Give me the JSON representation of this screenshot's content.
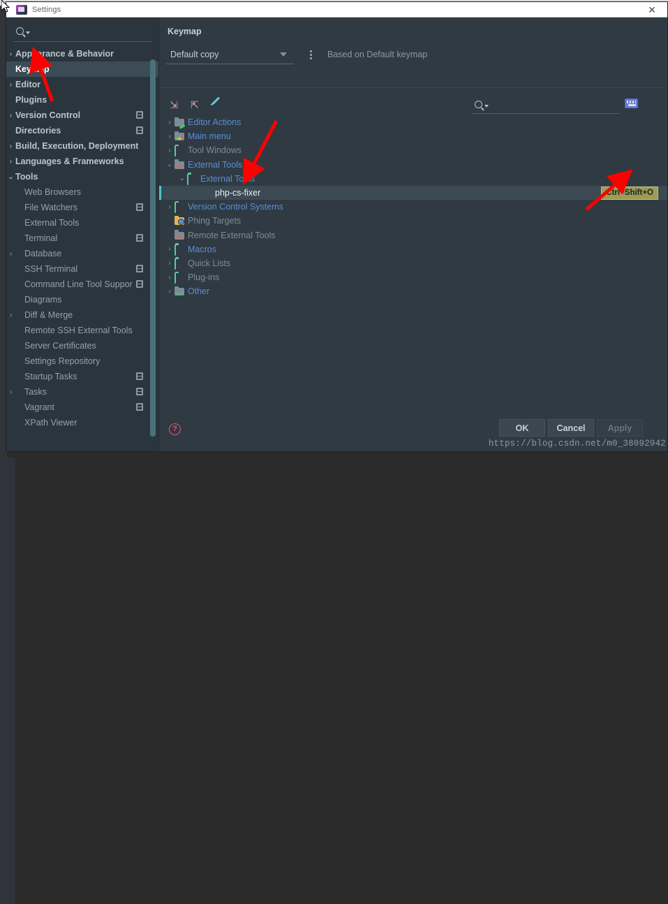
{
  "window": {
    "title": "Settings",
    "close_label": "✕",
    "app_icon": "settings-app-icon"
  },
  "sidebar": {
    "search": {
      "placeholder": "",
      "value": "",
      "icon": "search-icon"
    },
    "items": [
      {
        "label": "Appearance & Behavior",
        "arrow": "›",
        "level": 0,
        "style": "bold",
        "badge": false
      },
      {
        "label": "Keymap",
        "arrow": "",
        "level": 0,
        "style": "selected",
        "badge": false
      },
      {
        "label": "Editor",
        "arrow": "›",
        "level": 0,
        "style": "bold",
        "badge": false
      },
      {
        "label": "Plugins",
        "arrow": "",
        "level": 0,
        "style": "bold",
        "badge": false
      },
      {
        "label": "Version Control",
        "arrow": "›",
        "level": 0,
        "style": "bold",
        "badge": true
      },
      {
        "label": "Directories",
        "arrow": "",
        "level": 0,
        "style": "bold",
        "badge": true
      },
      {
        "label": "Build, Execution, Deployment",
        "arrow": "›",
        "level": 0,
        "style": "bold",
        "badge": false
      },
      {
        "label": "Languages & Frameworks",
        "arrow": "›",
        "level": 0,
        "style": "bold",
        "badge": false
      },
      {
        "label": "Tools",
        "arrow": "⌄",
        "level": 0,
        "style": "bold expanded",
        "badge": false
      },
      {
        "label": "Web Browsers",
        "arrow": "",
        "level": 1,
        "style": "normal",
        "badge": false
      },
      {
        "label": "File Watchers",
        "arrow": "",
        "level": 1,
        "style": "normal",
        "badge": true
      },
      {
        "label": "External Tools",
        "arrow": "",
        "level": 1,
        "style": "normal",
        "badge": false
      },
      {
        "label": "Terminal",
        "arrow": "",
        "level": 1,
        "style": "normal",
        "badge": true
      },
      {
        "label": "Database",
        "arrow": "›",
        "level": 1,
        "style": "normal",
        "badge": false
      },
      {
        "label": "SSH Terminal",
        "arrow": "",
        "level": 1,
        "style": "normal",
        "badge": true
      },
      {
        "label": "Command Line Tool Suppor",
        "arrow": "",
        "level": 1,
        "style": "normal",
        "badge": true
      },
      {
        "label": "Diagrams",
        "arrow": "",
        "level": 1,
        "style": "normal",
        "badge": false
      },
      {
        "label": "Diff & Merge",
        "arrow": "›",
        "level": 1,
        "style": "normal",
        "badge": false
      },
      {
        "label": "Remote SSH External Tools",
        "arrow": "",
        "level": 1,
        "style": "normal",
        "badge": false
      },
      {
        "label": "Server Certificates",
        "arrow": "",
        "level": 1,
        "style": "normal",
        "badge": false
      },
      {
        "label": "Settings Repository",
        "arrow": "",
        "level": 1,
        "style": "normal",
        "badge": false
      },
      {
        "label": "Startup Tasks",
        "arrow": "",
        "level": 1,
        "style": "normal",
        "badge": true
      },
      {
        "label": "Tasks",
        "arrow": "›",
        "level": 1,
        "style": "normal",
        "badge": true
      },
      {
        "label": "Vagrant",
        "arrow": "",
        "level": 1,
        "style": "normal",
        "badge": true
      },
      {
        "label": "XPath Viewer",
        "arrow": "",
        "level": 1,
        "style": "normal",
        "badge": false
      }
    ]
  },
  "main": {
    "title": "Keymap",
    "keymap_select": {
      "value": "Default copy",
      "caret": "▼"
    },
    "more_button": "more-options",
    "based_on": "Based on Default keymap",
    "toolbar": {
      "expand_all": "expand-all-icon",
      "collapse_all": "collapse-all-icon",
      "edit": "edit-shortcut-icon"
    },
    "tree_search": {
      "placeholder": "",
      "value": "",
      "icon": "search-icon"
    },
    "keyboard_filter": "keyboard-shortcut-filter-icon",
    "tree": [
      {
        "label": "Editor Actions",
        "twisty": "›",
        "icon": "folder-editor",
        "indent": 0,
        "color": "blue",
        "selected": false,
        "shortcut": ""
      },
      {
        "label": "Main menu",
        "twisty": "›",
        "icon": "folder-menu",
        "indent": 0,
        "color": "blue",
        "selected": false,
        "shortcut": ""
      },
      {
        "label": "Tool Windows",
        "twisty": "›",
        "icon": "folder-outline",
        "indent": 0,
        "color": "gray",
        "selected": false,
        "shortcut": ""
      },
      {
        "label": "External Tools",
        "twisty": "⌄",
        "icon": "folder-tools",
        "indent": 0,
        "color": "blue",
        "selected": false,
        "shortcut": ""
      },
      {
        "label": "External Tools",
        "twisty": "⌄",
        "icon": "folder-outline",
        "indent": 1,
        "color": "blue",
        "selected": false,
        "shortcut": ""
      },
      {
        "label": "php-cs-fixer",
        "twisty": "",
        "icon": "",
        "indent": 2,
        "color": "sel",
        "selected": true,
        "shortcut": "Ctrl+Shift+O"
      },
      {
        "label": "Version Control Systems",
        "twisty": "›",
        "icon": "folder-outline",
        "indent": 0,
        "color": "blue",
        "selected": false,
        "shortcut": ""
      },
      {
        "label": "Phing Targets",
        "twisty": "",
        "icon": "folder-phing",
        "indent": 0,
        "color": "gray",
        "selected": false,
        "shortcut": ""
      },
      {
        "label": "Remote External Tools",
        "twisty": "",
        "icon": "folder-tools",
        "indent": 0,
        "color": "gray",
        "selected": false,
        "shortcut": ""
      },
      {
        "label": "Macros",
        "twisty": "›",
        "icon": "folder-outline",
        "indent": 0,
        "color": "blue",
        "selected": false,
        "shortcut": ""
      },
      {
        "label": "Quick Lists",
        "twisty": "›",
        "icon": "folder-outline",
        "indent": 0,
        "color": "gray",
        "selected": false,
        "shortcut": ""
      },
      {
        "label": "Plug-ins",
        "twisty": "›",
        "icon": "folder-outline",
        "indent": 0,
        "color": "gray",
        "selected": false,
        "shortcut": ""
      },
      {
        "label": "Other",
        "twisty": "›",
        "icon": "folder-other",
        "indent": 0,
        "color": "blue",
        "selected": false,
        "shortcut": ""
      }
    ]
  },
  "footer": {
    "help": "?",
    "ok": "OK",
    "cancel": "Cancel",
    "apply": "Apply",
    "watermark": "https://blog.csdn.net/m0_38092942"
  },
  "colors": {
    "accent_selection": "#55c4c9",
    "tree_link": "#5b8dd9",
    "shortcut_badge_bg": "#9c9c53",
    "shortcut_badge_border": "#c3c37a",
    "annotation_arrow": "#fe0000",
    "dialog_bg": "#2f3a42",
    "sidebar_bg": "#2b353d"
  }
}
